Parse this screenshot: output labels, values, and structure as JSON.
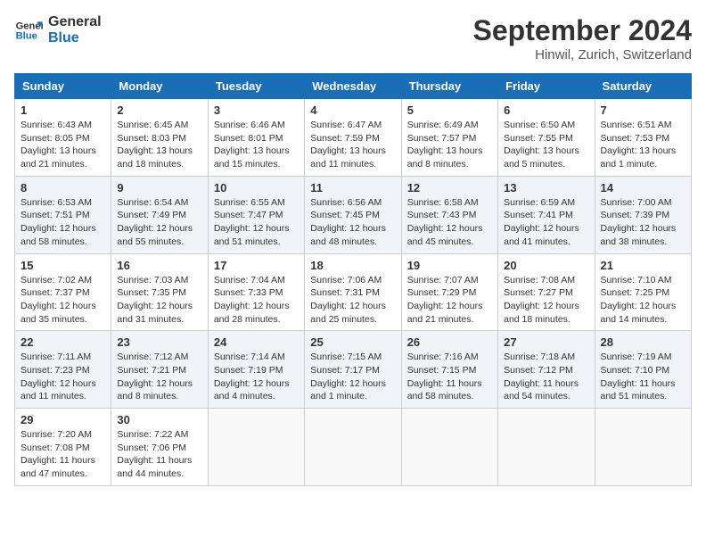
{
  "header": {
    "logo_line1": "General",
    "logo_line2": "Blue",
    "month": "September 2024",
    "location": "Hinwil, Zurich, Switzerland"
  },
  "days_of_week": [
    "Sunday",
    "Monday",
    "Tuesday",
    "Wednesday",
    "Thursday",
    "Friday",
    "Saturday"
  ],
  "weeks": [
    [
      {
        "day": "1",
        "sunrise": "6:43 AM",
        "sunset": "8:05 PM",
        "daylight": "13 hours and 21 minutes."
      },
      {
        "day": "2",
        "sunrise": "6:45 AM",
        "sunset": "8:03 PM",
        "daylight": "13 hours and 18 minutes."
      },
      {
        "day": "3",
        "sunrise": "6:46 AM",
        "sunset": "8:01 PM",
        "daylight": "13 hours and 15 minutes."
      },
      {
        "day": "4",
        "sunrise": "6:47 AM",
        "sunset": "7:59 PM",
        "daylight": "13 hours and 11 minutes."
      },
      {
        "day": "5",
        "sunrise": "6:49 AM",
        "sunset": "7:57 PM",
        "daylight": "13 hours and 8 minutes."
      },
      {
        "day": "6",
        "sunrise": "6:50 AM",
        "sunset": "7:55 PM",
        "daylight": "13 hours and 5 minutes."
      },
      {
        "day": "7",
        "sunrise": "6:51 AM",
        "sunset": "7:53 PM",
        "daylight": "13 hours and 1 minute."
      }
    ],
    [
      {
        "day": "8",
        "sunrise": "6:53 AM",
        "sunset": "7:51 PM",
        "daylight": "12 hours and 58 minutes."
      },
      {
        "day": "9",
        "sunrise": "6:54 AM",
        "sunset": "7:49 PM",
        "daylight": "12 hours and 55 minutes."
      },
      {
        "day": "10",
        "sunrise": "6:55 AM",
        "sunset": "7:47 PM",
        "daylight": "12 hours and 51 minutes."
      },
      {
        "day": "11",
        "sunrise": "6:56 AM",
        "sunset": "7:45 PM",
        "daylight": "12 hours and 48 minutes."
      },
      {
        "day": "12",
        "sunrise": "6:58 AM",
        "sunset": "7:43 PM",
        "daylight": "12 hours and 45 minutes."
      },
      {
        "day": "13",
        "sunrise": "6:59 AM",
        "sunset": "7:41 PM",
        "daylight": "12 hours and 41 minutes."
      },
      {
        "day": "14",
        "sunrise": "7:00 AM",
        "sunset": "7:39 PM",
        "daylight": "12 hours and 38 minutes."
      }
    ],
    [
      {
        "day": "15",
        "sunrise": "7:02 AM",
        "sunset": "7:37 PM",
        "daylight": "12 hours and 35 minutes."
      },
      {
        "day": "16",
        "sunrise": "7:03 AM",
        "sunset": "7:35 PM",
        "daylight": "12 hours and 31 minutes."
      },
      {
        "day": "17",
        "sunrise": "7:04 AM",
        "sunset": "7:33 PM",
        "daylight": "12 hours and 28 minutes."
      },
      {
        "day": "18",
        "sunrise": "7:06 AM",
        "sunset": "7:31 PM",
        "daylight": "12 hours and 25 minutes."
      },
      {
        "day": "19",
        "sunrise": "7:07 AM",
        "sunset": "7:29 PM",
        "daylight": "12 hours and 21 minutes."
      },
      {
        "day": "20",
        "sunrise": "7:08 AM",
        "sunset": "7:27 PM",
        "daylight": "12 hours and 18 minutes."
      },
      {
        "day": "21",
        "sunrise": "7:10 AM",
        "sunset": "7:25 PM",
        "daylight": "12 hours and 14 minutes."
      }
    ],
    [
      {
        "day": "22",
        "sunrise": "7:11 AM",
        "sunset": "7:23 PM",
        "daylight": "12 hours and 11 minutes."
      },
      {
        "day": "23",
        "sunrise": "7:12 AM",
        "sunset": "7:21 PM",
        "daylight": "12 hours and 8 minutes."
      },
      {
        "day": "24",
        "sunrise": "7:14 AM",
        "sunset": "7:19 PM",
        "daylight": "12 hours and 4 minutes."
      },
      {
        "day": "25",
        "sunrise": "7:15 AM",
        "sunset": "7:17 PM",
        "daylight": "12 hours and 1 minute."
      },
      {
        "day": "26",
        "sunrise": "7:16 AM",
        "sunset": "7:15 PM",
        "daylight": "11 hours and 58 minutes."
      },
      {
        "day": "27",
        "sunrise": "7:18 AM",
        "sunset": "7:12 PM",
        "daylight": "11 hours and 54 minutes."
      },
      {
        "day": "28",
        "sunrise": "7:19 AM",
        "sunset": "7:10 PM",
        "daylight": "11 hours and 51 minutes."
      }
    ],
    [
      {
        "day": "29",
        "sunrise": "7:20 AM",
        "sunset": "7:08 PM",
        "daylight": "11 hours and 47 minutes."
      },
      {
        "day": "30",
        "sunrise": "7:22 AM",
        "sunset": "7:06 PM",
        "daylight": "11 hours and 44 minutes."
      },
      null,
      null,
      null,
      null,
      null
    ]
  ]
}
